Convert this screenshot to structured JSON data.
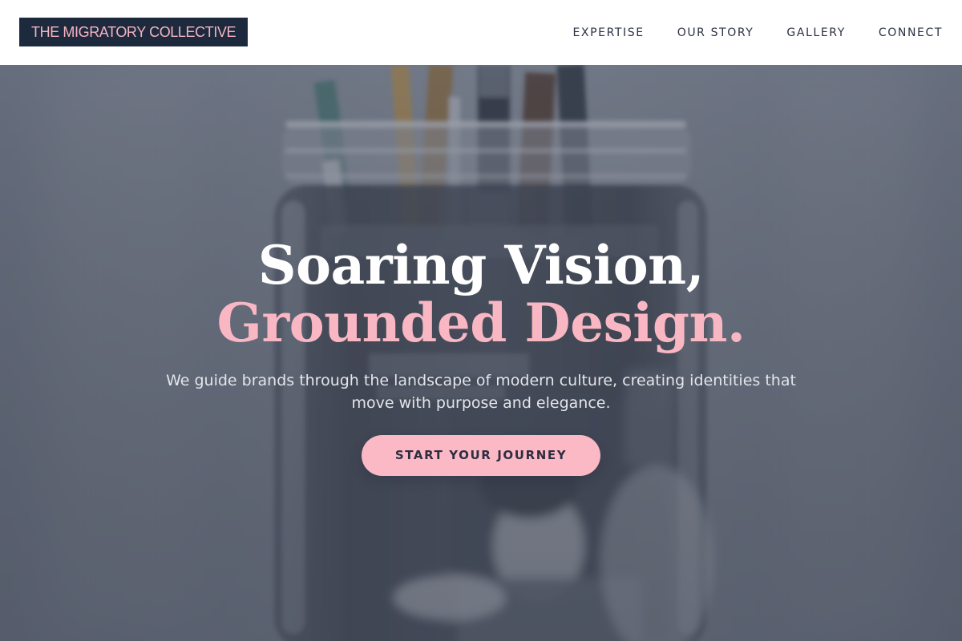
{
  "brand": {
    "logo_text": "THE MIGRATORY COLLECTIVE"
  },
  "nav": {
    "items": [
      {
        "label": "EXPERTISE"
      },
      {
        "label": "OUR STORY"
      },
      {
        "label": "GALLERY"
      },
      {
        "label": "CONNECT"
      }
    ]
  },
  "hero": {
    "headline_line1": "Soaring Vision,",
    "headline_line2": "Grounded Design.",
    "subtitle": "We guide brands through the landscape of modern culture, creating identities that move with purpose and elegance.",
    "cta_label": "START YOUR JOURNEY",
    "background_image": "glass-jar-with-paintbrushes-photo"
  },
  "colors": {
    "header_bg": "#ffffff",
    "logo_bg": "#1d2a3e",
    "logo_text": "#f5b3c1",
    "nav_text": "#2b3243",
    "headline_white": "#ffffff",
    "accent_pink": "#f9b6c3",
    "cta_bg": "#fbb8c5",
    "cta_text": "#2e2e40"
  }
}
